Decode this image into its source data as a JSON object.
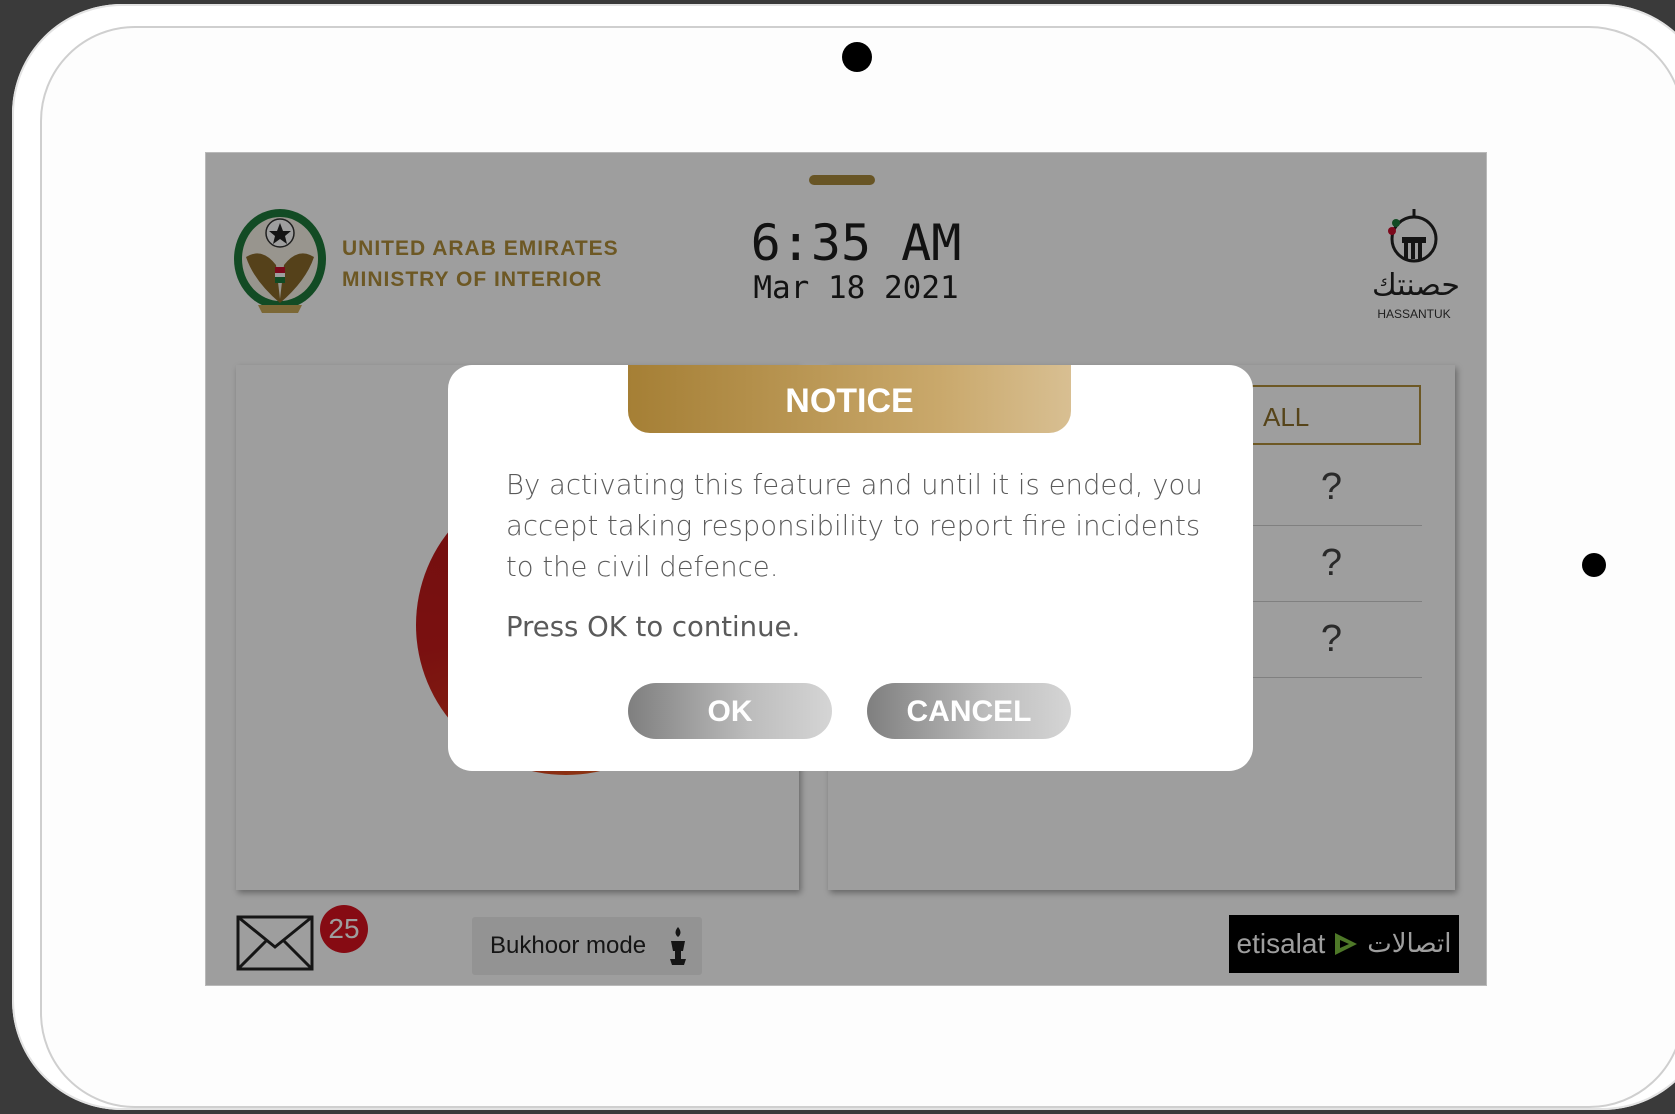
{
  "header": {
    "ministry_line1": "UNITED ARAB EMIRATES",
    "ministry_line2": "MINISTRY OF INTERIOR",
    "time": "6:35 AM",
    "date": "Mar 18 2021",
    "brand_logo_name": "حصنتك",
    "brand_label": "HASSANTUK"
  },
  "filters": {
    "all_label": "ALL",
    "rows": [
      "?",
      "?",
      "?"
    ]
  },
  "footer": {
    "messages_count": "25",
    "bukhoor_label": "Bukhoor mode",
    "carrier_latin": "etisalat",
    "carrier_arabic": "اتصالات"
  },
  "dialog": {
    "title": "NOTICE",
    "body": "By activating this feature and until it is ended, you accept taking responsibility to report fire incidents to the civil defence.",
    "hint": "Press OK to continue.",
    "ok_label": "OK",
    "cancel_label": "CANCEL"
  },
  "colors": {
    "gold_accent": "#b08e3b",
    "badge_red": "#d9121f"
  }
}
